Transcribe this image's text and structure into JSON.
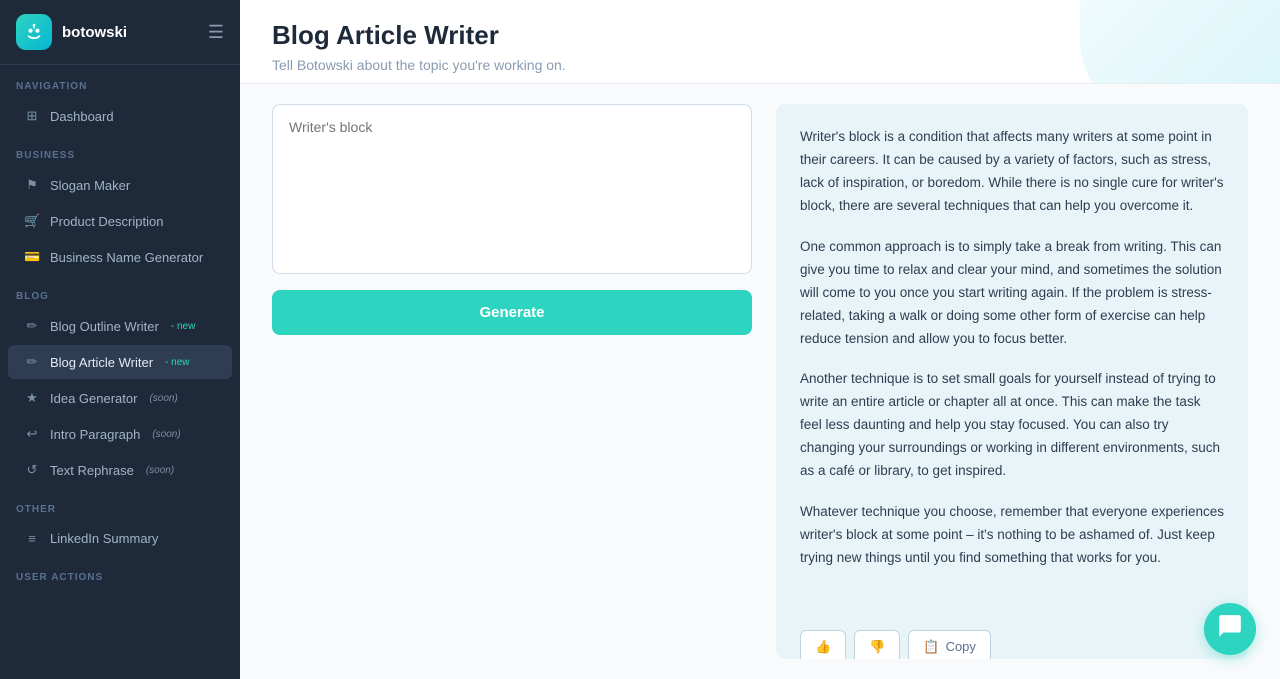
{
  "app": {
    "logo_icon": "🤖",
    "name": "botowski",
    "hamburger": "☰"
  },
  "sidebar": {
    "navigation_label": "NAVIGATION",
    "items_nav": [
      {
        "label": "Dashboard",
        "icon": "⊞",
        "active": false
      }
    ],
    "business_label": "BUSINESS",
    "items_business": [
      {
        "label": "Slogan Maker",
        "icon": "⚑",
        "active": false
      },
      {
        "label": "Product Description",
        "icon": "🛒",
        "active": false
      },
      {
        "label": "Business Name Generator",
        "icon": "💳",
        "active": false
      }
    ],
    "blog_label": "BLOG",
    "items_blog": [
      {
        "label": "Blog Outline Writer",
        "badge": "new",
        "icon": "✏",
        "active": false
      },
      {
        "label": "Blog Article Writer",
        "badge": "new",
        "icon": "✏",
        "active": true
      },
      {
        "label": "Idea Generator",
        "badge": "soon",
        "icon": "★",
        "active": false
      },
      {
        "label": "Intro Paragraph",
        "badge": "soon",
        "icon": "↩",
        "active": false
      },
      {
        "label": "Text Rephrase",
        "badge": "soon",
        "icon": "↺",
        "active": false
      }
    ],
    "other_label": "OTHER",
    "items_other": [
      {
        "label": "LinkedIn Summary",
        "icon": "≡",
        "active": false
      }
    ],
    "user_actions_label": "USER ACTIONS"
  },
  "page": {
    "title": "Blog Article Writer",
    "subtitle": "Tell Botowski about the topic you're working on."
  },
  "input": {
    "placeholder": "Writer's block",
    "generate_label": "Generate"
  },
  "output": {
    "paragraphs": [
      "Writer's block is a condition that affects many writers at some point in their careers. It can be caused by a variety of factors, such as stress, lack of inspiration, or boredom. While there is no single cure for writer's block, there are several techniques that can help you overcome it.",
      "One common approach is to simply take a break from writing. This can give you time to relax and clear your mind, and sometimes the solution will come to you once you start writing again. If the problem is stress-related, taking a walk or doing some other form of exercise can help reduce tension and allow you to focus better.",
      "Another technique is to set small goals for yourself instead of trying to write an entire article or chapter all at once. This can make the task feel less daunting and help you stay focused. You can also try changing your surroundings or working in different environments, such as a café or library, to get inspired.",
      "Whatever technique you choose, remember that everyone experiences writer's block at some point – it's nothing to be ashamed of. Just keep trying new things until you find something that works for you."
    ]
  },
  "actions": {
    "thumbs_up": "👍",
    "thumbs_down": "👎",
    "copy_icon": "📋",
    "copy_label": "Copy"
  },
  "chat": {
    "icon": "💬"
  }
}
